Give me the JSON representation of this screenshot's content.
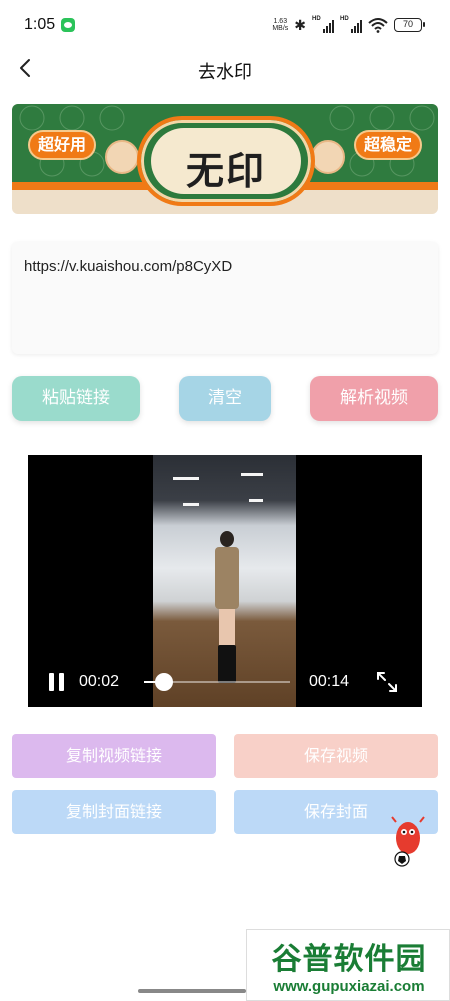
{
  "status_bar": {
    "time": "1:05",
    "net_speed_value": "1.63",
    "net_speed_unit": "MB/s",
    "sim1_label": "HD",
    "sim2_label": "HD",
    "battery": "70",
    "icons": [
      "wechat-icon",
      "bluetooth-icon",
      "signal-icon",
      "wifi-icon",
      "battery-icon"
    ]
  },
  "header": {
    "title": "去水印",
    "back_icon": "chevron-left-icon"
  },
  "banner": {
    "left_tag": "超好用",
    "main_text": "无印",
    "right_tag": "超稳定",
    "colors": {
      "green": "#2f7b3f",
      "orange": "#f07a16",
      "cream": "#eedfc9"
    }
  },
  "url_input": {
    "value": "https://v.kuaishou.com/p8CyXD"
  },
  "actions": {
    "paste_label": "粘贴链接",
    "clear_label": "清空",
    "parse_label": "解析视频"
  },
  "player": {
    "current_time": "00:02",
    "total_time": "00:14",
    "progress": 0.14,
    "state": "playing",
    "fullscreen_icon": "fullscreen-expand-icon"
  },
  "result_buttons": {
    "copy_video_link": "复制视频链接",
    "save_video": "保存视频",
    "copy_cover_link": "复制封面链接",
    "save_cover": "保存封面"
  },
  "watermark": {
    "title": "谷普软件园",
    "url": "www.gupuxiazai.com"
  }
}
